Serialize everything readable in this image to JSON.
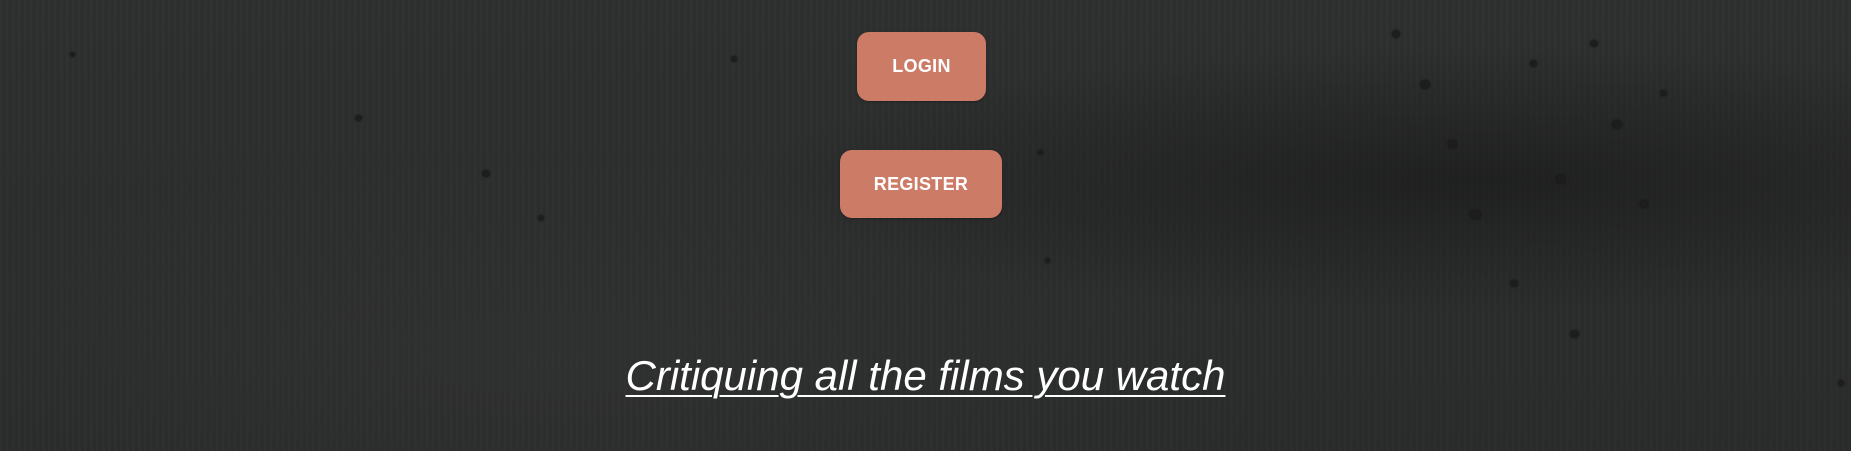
{
  "auth": {
    "login_label": "LOGIN",
    "register_label": "REGISTER"
  },
  "hero": {
    "tagline": "Critiquing all the films you watch"
  },
  "colors": {
    "background": "#2b2d2c",
    "button": "#cc7c66",
    "text": "#ffffff"
  }
}
